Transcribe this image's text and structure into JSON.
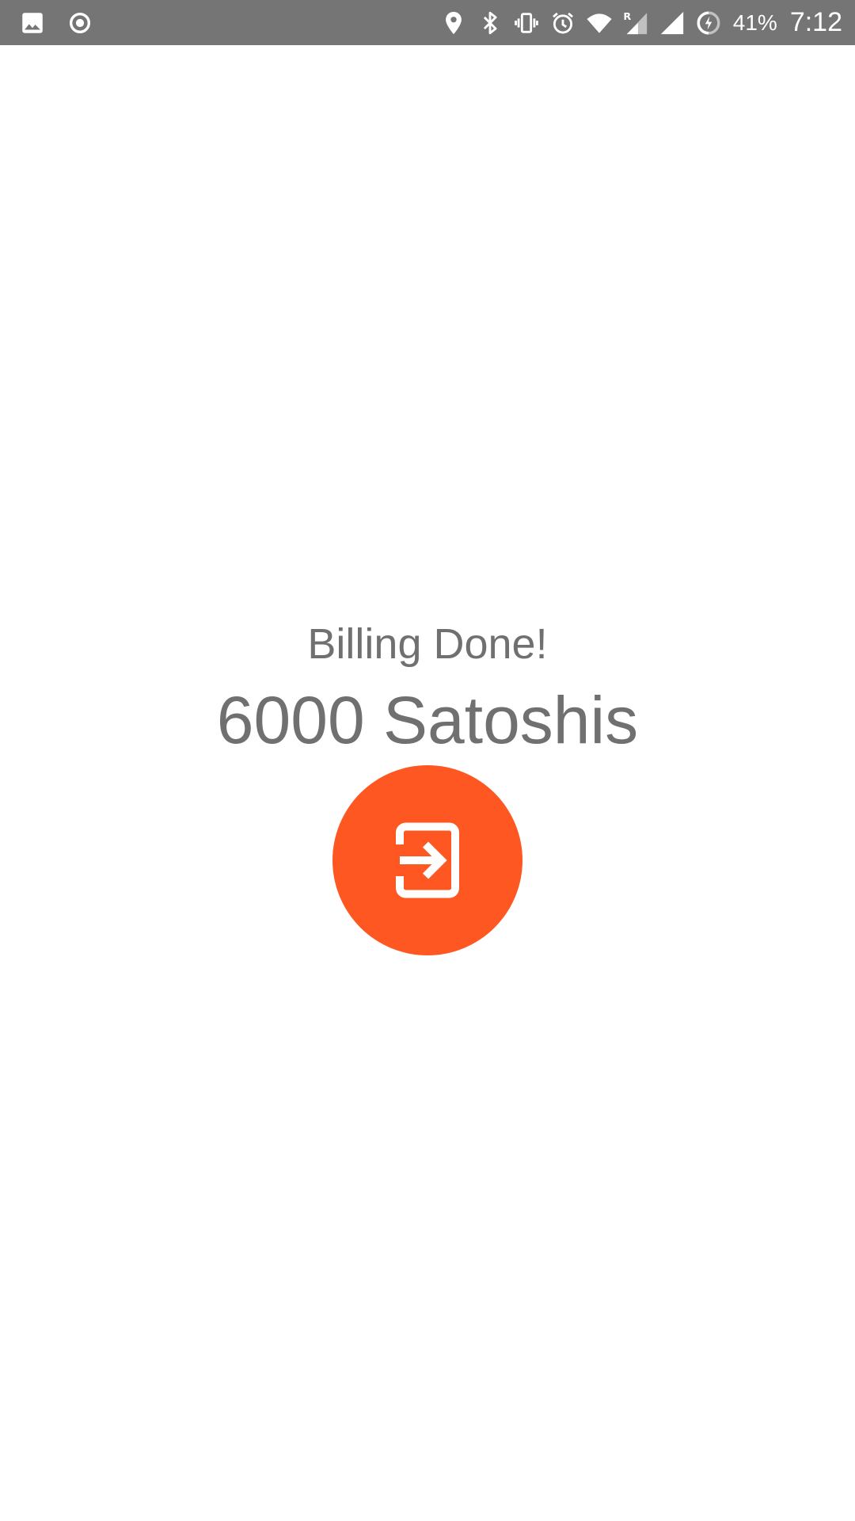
{
  "status_bar": {
    "left_icons": [
      "image-icon",
      "record-icon"
    ],
    "right_icons": [
      "location-icon",
      "bluetooth-icon",
      "vibrate-icon",
      "alarm-icon",
      "wifi-icon",
      "roaming-signal-icon",
      "signal-icon",
      "battery-charging-icon"
    ],
    "roaming_label": "R",
    "battery_percent": "41%",
    "time": "7:12",
    "background_color": "#757575"
  },
  "main": {
    "title": "Billing Done!",
    "amount": "6000 Satoshis",
    "text_color": "#707070"
  },
  "action_button": {
    "icon": "exit-to-app-icon",
    "color": "#ff5722"
  }
}
